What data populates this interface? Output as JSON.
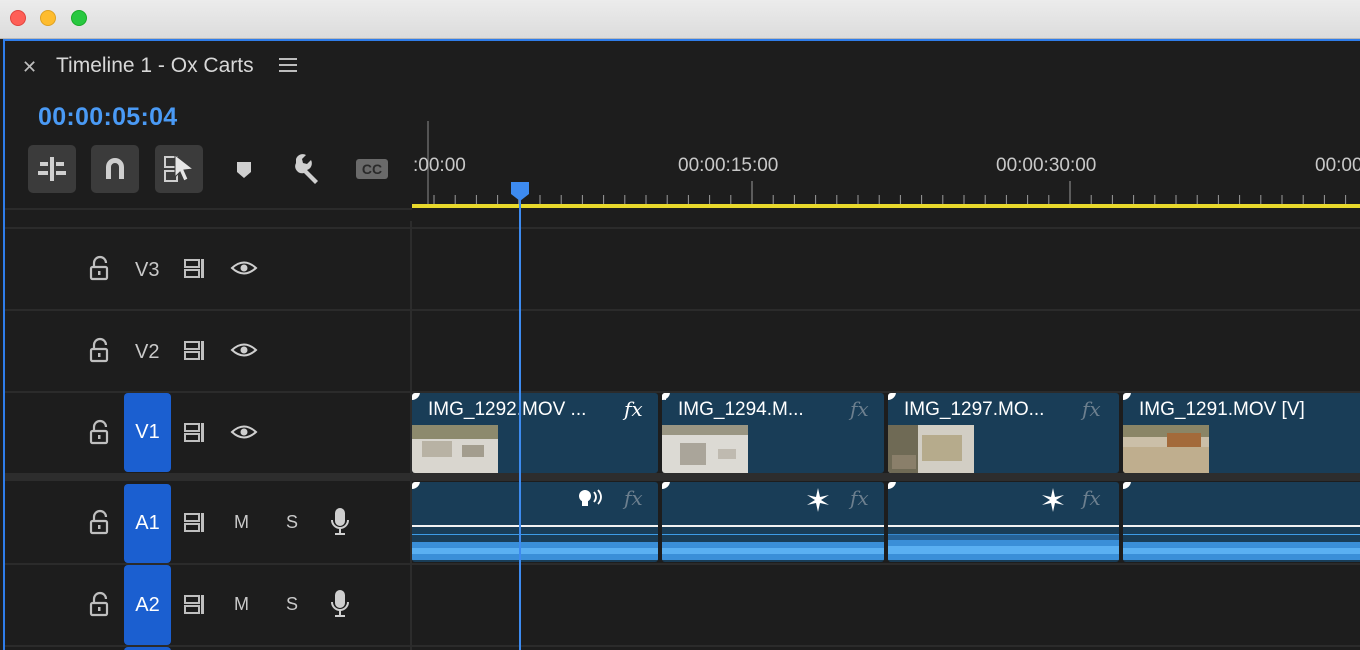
{
  "window": {
    "lights": {
      "close": "#fe5f57",
      "minimize": "#febc2e",
      "maximize": "#28c840"
    }
  },
  "panel": {
    "title": "Timeline 1 - Ox Carts",
    "timecode": "00:00:05:04",
    "accent": "#2f7dea"
  },
  "toolbar": {
    "icons": [
      "insert-nest-icon",
      "snap-magnet-icon",
      "linked-selection-icon",
      "marker-icon",
      "wrench-icon",
      "captions-icon"
    ],
    "cc_label": "CC"
  },
  "ruler": {
    "labels": [
      ":00:00",
      "00:00:15:00",
      "00:00:30:00",
      "00:00"
    ],
    "playhead_color": "#3d8bf0",
    "work_area_color": "#e8d92c"
  },
  "tracks": {
    "video": [
      {
        "label": "V3",
        "selected": false
      },
      {
        "label": "V2",
        "selected": false
      },
      {
        "label": "V1",
        "selected": true
      }
    ],
    "audio": [
      {
        "label": "A1",
        "selected": true,
        "mute": "M",
        "solo": "S"
      },
      {
        "label": "A2",
        "selected": true,
        "mute": "M",
        "solo": "S"
      }
    ]
  },
  "clips": {
    "video": [
      {
        "name": "IMG_1292.MOV ...",
        "fx": "fx",
        "fx_active": true
      },
      {
        "name": "IMG_1294.M...",
        "fx": "fx",
        "fx_active": false
      },
      {
        "name": "IMG_1297.MO...",
        "fx": "fx",
        "fx_active": false
      },
      {
        "name": "IMG_1291.MOV [V]",
        "fx": "",
        "fx_active": false
      }
    ],
    "audio": [
      {
        "fx": "fx",
        "badge": "speech-icon"
      },
      {
        "fx": "fx",
        "badge": "sparkle-icon"
      },
      {
        "fx": "fx",
        "badge": "sparkle-icon"
      },
      {
        "fx": "",
        "badge": ""
      }
    ]
  }
}
